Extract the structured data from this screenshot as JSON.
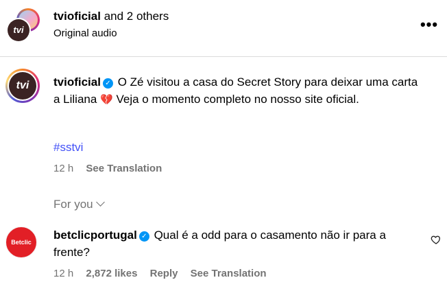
{
  "header": {
    "account": "tvioficial",
    "others_text": " and 2 others",
    "subtitle": "Original audio",
    "more_label": "•••",
    "avatar_text": "tvi"
  },
  "post": {
    "avatar_text": "tvi",
    "username": "tvioficial",
    "verified_mark": "✓",
    "caption_part1": " O Zé visitou a casa do Secret Story para deixar uma carta a Liliana ",
    "broken_heart": "💔",
    "caption_part2": "  Veja o momento completo no nosso site oficial.",
    "hashtag": "#sstvi",
    "time": "12 h",
    "see_translation": "See Translation"
  },
  "for_you": {
    "label": "For you"
  },
  "comment": {
    "avatar_text": "Betclic",
    "username": "betclicportugal",
    "verified_mark": "✓",
    "text": " Qual é a odd para o casamento não ir para a frente?",
    "time": "12 h",
    "likes": "2,872 likes",
    "reply": "Reply",
    "see_translation": "See Translation"
  },
  "colors": {
    "verified": "#0095f6",
    "hashtag": "#4150f7",
    "muted": "#737373",
    "betclic_red": "#e21f26"
  }
}
